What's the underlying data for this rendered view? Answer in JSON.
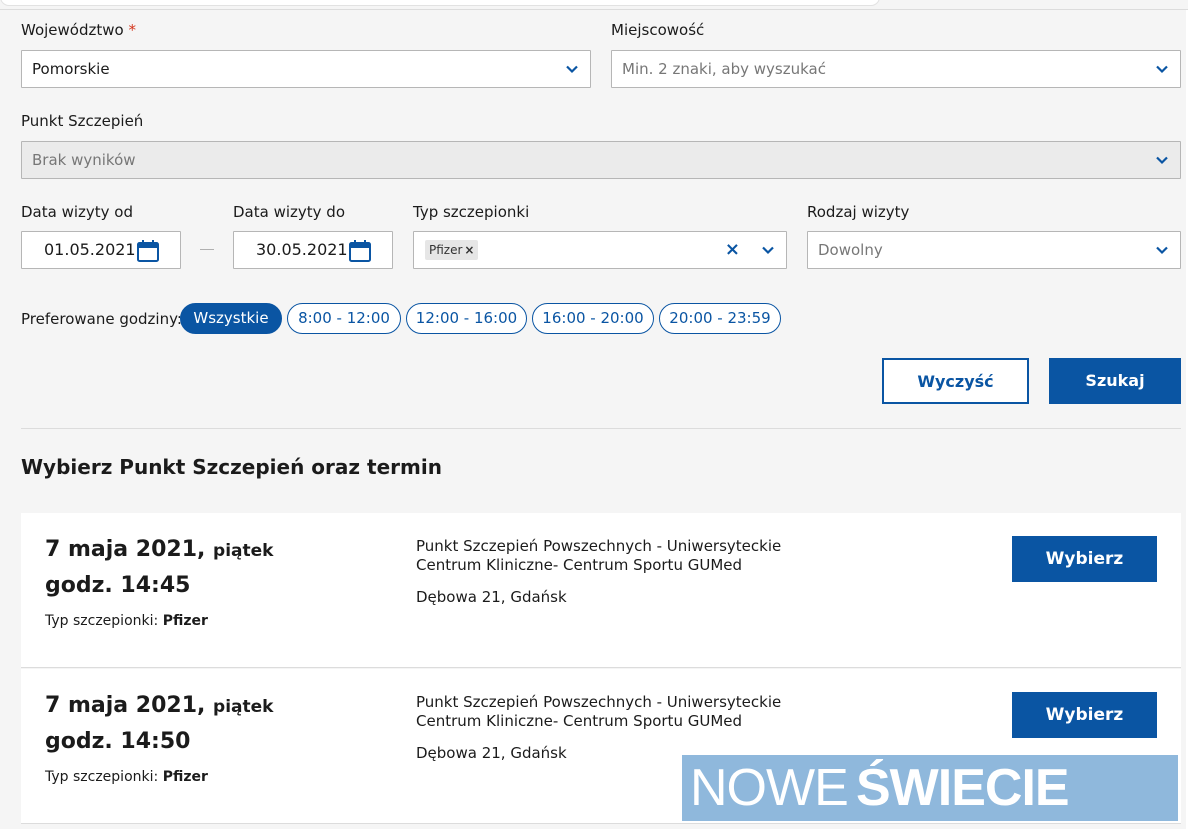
{
  "filters": {
    "wojewodztwo": {
      "label": "Województwo",
      "required_mark": "*",
      "value": "Pomorskie"
    },
    "miejscowosc": {
      "label": "Miejscowość",
      "placeholder": "Min. 2 znaki, aby wyszukać"
    },
    "punkt": {
      "label": "Punkt Szczepień",
      "value": "Brak wyników"
    },
    "data_od": {
      "label": "Data wizyty od",
      "value": "01.05.2021"
    },
    "data_do": {
      "label": "Data wizyty do",
      "value": "30.05.2021"
    },
    "typ": {
      "label": "Typ szczepionki",
      "tag": "Pfizer",
      "tag_remove": "×",
      "clear": "×"
    },
    "rodzaj": {
      "label": "Rodzaj wizyty",
      "placeholder": "Dowolny"
    }
  },
  "hours": {
    "label": "Preferowane godziny:",
    "options": [
      "Wszystkie",
      "8:00 - 12:00",
      "12:00 - 16:00",
      "16:00 - 20:00",
      "20:00 - 23:59"
    ],
    "selected": "Wszystkie"
  },
  "actions": {
    "clear": "Wyczyść",
    "search": "Szukaj"
  },
  "results": {
    "title": "Wybierz Punkt Szczepień oraz termin",
    "items": [
      {
        "date": "7 maja 2021,",
        "weekday": "piątek",
        "time": "godz. 14:45",
        "type_label": "Typ szczepionki:",
        "type": "Pfizer",
        "place": "Punkt Szczepień Powszechnych - Uniwersyteckie Centrum Kliniczne- Centrum Sportu GUMed",
        "address": "Dębowa 21, Gdańsk",
        "button": "Wybierz"
      },
      {
        "date": "7 maja 2021,",
        "weekday": "piątek",
        "time": "godz. 14:50",
        "type_label": "Typ szczepionki:",
        "type": "Pfizer",
        "place": "Punkt Szczepień Powszechnych - Uniwersyteckie Centrum Kliniczne- Centrum Sportu GUMed",
        "address": "Dębowa 21, Gdańsk",
        "button": "Wybierz"
      }
    ]
  },
  "watermark": {
    "part1": "NOWE",
    "part2": "ŚWIECIE"
  },
  "colors": {
    "primary": "#0a55a3",
    "background": "#f5f5f5",
    "required": "#d4351c"
  },
  "icons": {
    "dropdown": "chevron-down-icon",
    "calendar": "calendar-icon",
    "clear": "close-icon"
  }
}
